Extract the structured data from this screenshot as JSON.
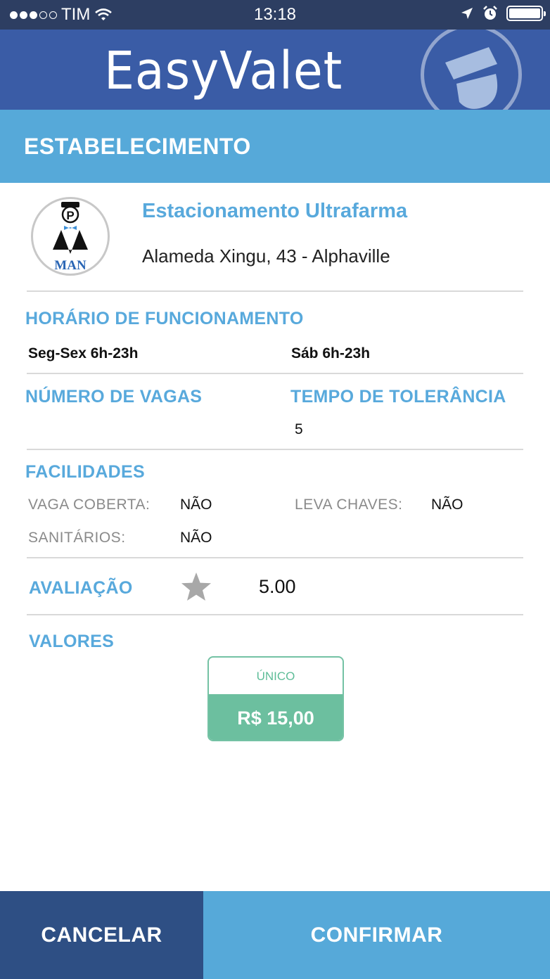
{
  "status_bar": {
    "carrier": "TIM",
    "time": "13:18"
  },
  "header": {
    "app_name": "EasyValet"
  },
  "section": {
    "title": "ESTABELECIMENTO"
  },
  "establishment": {
    "name": "Estacionamento Ultrafarma",
    "address": "Alameda Xingu, 43 - Alphaville",
    "logo_text": "MAN",
    "logo_badge": "P"
  },
  "hours": {
    "title": "HORÁRIO DE FUNCIONAMENTO",
    "weekdays": "Seg-Sex 6h-23h",
    "saturday": "Sáb 6h-23h"
  },
  "spots": {
    "title": "NÚMERO DE VAGAS",
    "value": ""
  },
  "tolerance": {
    "title": "TEMPO DE TOLERÂNCIA",
    "value": "5"
  },
  "facilities": {
    "title": "FACILIDADES",
    "items": [
      {
        "label": "VAGA COBERTA:",
        "value": "NÃO"
      },
      {
        "label": "LEVA CHAVES:",
        "value": "NÃO"
      },
      {
        "label": "SANITÁRIOS:",
        "value": "NÃO"
      }
    ]
  },
  "rating": {
    "title": "AVALIAÇÃO",
    "value": "5.00"
  },
  "prices": {
    "title": "VALORES",
    "items": [
      {
        "type": "ÚNICO",
        "value": "R$ 15,00"
      }
    ]
  },
  "footer": {
    "cancel_label": "CANCELAR",
    "confirm_label": "CONFIRMAR"
  },
  "colors": {
    "status_bar": "#2d3e62",
    "header": "#3a5ca6",
    "section_bar": "#56a9d9",
    "accent_blue": "#58a9dc",
    "price_green": "#6cbf9f",
    "cancel_button": "#2e4f84",
    "confirm_button": "#56a9d9"
  },
  "icons": [
    "wifi-icon",
    "location-arrow-icon",
    "alarm-icon",
    "battery-icon",
    "valet-hat-icon",
    "star-icon"
  ]
}
